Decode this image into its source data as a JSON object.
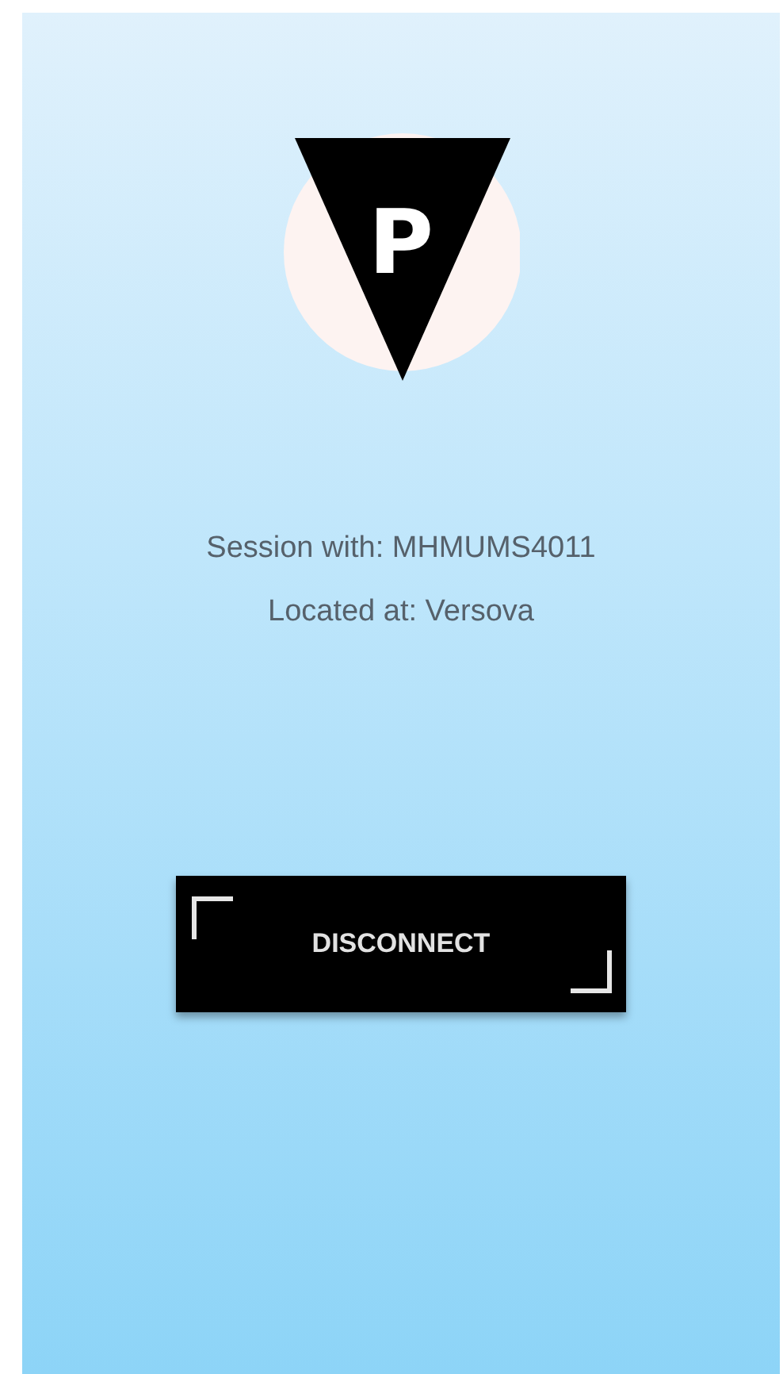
{
  "logo": {
    "letter": "P"
  },
  "session": {
    "label": "Session with: MHMUMS4011",
    "location": "Located at: Versova"
  },
  "button": {
    "label": "DISCONNECT"
  }
}
